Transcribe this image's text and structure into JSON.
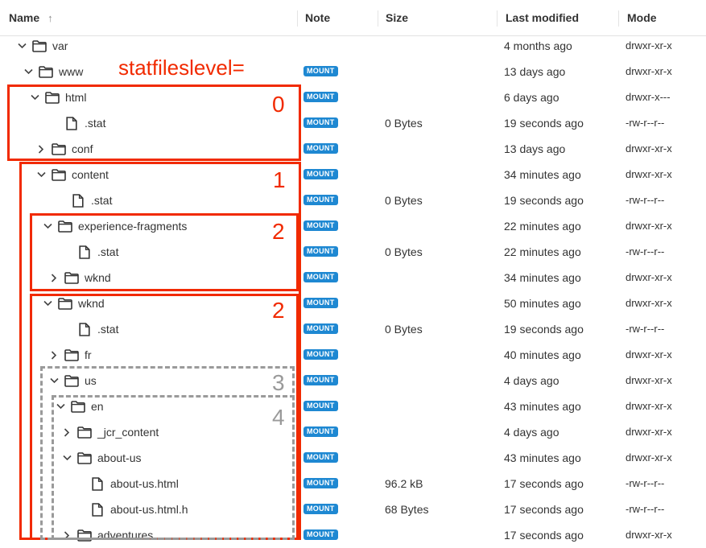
{
  "header": {
    "name": "Name",
    "note": "Note",
    "size": "Size",
    "modified": "Last modified",
    "mode": "Mode",
    "sort_icon": "arrow-up-icon"
  },
  "annotation": {
    "label": "statfileslevel=",
    "levels": [
      "0",
      "1",
      "2",
      "2",
      "3",
      "4"
    ],
    "colors": {
      "red": "#f12a00",
      "gray": "#9a9a9a"
    }
  },
  "badge_color": "#1e88d2",
  "rows": [
    {
      "name": "var",
      "kind": "folder",
      "expand": "open",
      "note": "",
      "size": "",
      "modified": "4 months ago",
      "mode": "drwxr-xr-x"
    },
    {
      "name": "www",
      "kind": "folder",
      "expand": "open",
      "note": "MOUNT",
      "size": "",
      "modified": "13 days ago",
      "mode": "drwxr-xr-x"
    },
    {
      "name": "html",
      "kind": "folder",
      "expand": "open",
      "note": "MOUNT",
      "size": "",
      "modified": "6 days ago",
      "mode": "drwxr-x---"
    },
    {
      "name": ".stat",
      "kind": "file",
      "expand": "none",
      "note": "MOUNT",
      "size": "0 Bytes",
      "modified": "19 seconds ago",
      "mode": "-rw-r--r--"
    },
    {
      "name": "conf",
      "kind": "folder",
      "expand": "closed",
      "note": "MOUNT",
      "size": "",
      "modified": "13 days ago",
      "mode": "drwxr-xr-x"
    },
    {
      "name": "content",
      "kind": "folder",
      "expand": "open",
      "note": "MOUNT",
      "size": "",
      "modified": "34 minutes ago",
      "mode": "drwxr-xr-x"
    },
    {
      "name": ".stat",
      "kind": "file",
      "expand": "none",
      "note": "MOUNT",
      "size": "0 Bytes",
      "modified": "19 seconds ago",
      "mode": "-rw-r--r--"
    },
    {
      "name": "experience-fragments",
      "kind": "folder",
      "expand": "open",
      "note": "MOUNT",
      "size": "",
      "modified": "22 minutes ago",
      "mode": "drwxr-xr-x"
    },
    {
      "name": ".stat",
      "kind": "file",
      "expand": "none",
      "note": "MOUNT",
      "size": "0 Bytes",
      "modified": "22 minutes ago",
      "mode": "-rw-r--r--"
    },
    {
      "name": "wknd",
      "kind": "folder",
      "expand": "closed",
      "note": "MOUNT",
      "size": "",
      "modified": "34 minutes ago",
      "mode": "drwxr-xr-x"
    },
    {
      "name": "wknd",
      "kind": "folder",
      "expand": "open",
      "note": "MOUNT",
      "size": "",
      "modified": "50 minutes ago",
      "mode": "drwxr-xr-x"
    },
    {
      "name": ".stat",
      "kind": "file",
      "expand": "none",
      "note": "MOUNT",
      "size": "0 Bytes",
      "modified": "19 seconds ago",
      "mode": "-rw-r--r--"
    },
    {
      "name": "fr",
      "kind": "folder",
      "expand": "closed",
      "note": "MOUNT",
      "size": "",
      "modified": "40 minutes ago",
      "mode": "drwxr-xr-x"
    },
    {
      "name": "us",
      "kind": "folder",
      "expand": "open",
      "note": "MOUNT",
      "size": "",
      "modified": "4 days ago",
      "mode": "drwxr-xr-x"
    },
    {
      "name": "en",
      "kind": "folder",
      "expand": "open",
      "note": "MOUNT",
      "size": "",
      "modified": "43 minutes ago",
      "mode": "drwxr-xr-x"
    },
    {
      "name": "_jcr_content",
      "kind": "folder",
      "expand": "closed",
      "note": "MOUNT",
      "size": "",
      "modified": "4 days ago",
      "mode": "drwxr-xr-x"
    },
    {
      "name": "about-us",
      "kind": "folder",
      "expand": "open",
      "note": "MOUNT",
      "size": "",
      "modified": "43 minutes ago",
      "mode": "drwxr-xr-x"
    },
    {
      "name": "about-us.html",
      "kind": "file",
      "expand": "none",
      "note": "MOUNT",
      "size": "96.2 kB",
      "modified": "17 seconds ago",
      "mode": "-rw-r--r--"
    },
    {
      "name": "about-us.html.h",
      "kind": "file",
      "expand": "none",
      "note": "MOUNT",
      "size": "68 Bytes",
      "modified": "17 seconds ago",
      "mode": "-rw-r--r--"
    },
    {
      "name": "adventures",
      "kind": "folder",
      "expand": "closed",
      "note": "MOUNT",
      "size": "",
      "modified": "17 seconds ago",
      "mode": "drwxr-xr-x"
    }
  ]
}
